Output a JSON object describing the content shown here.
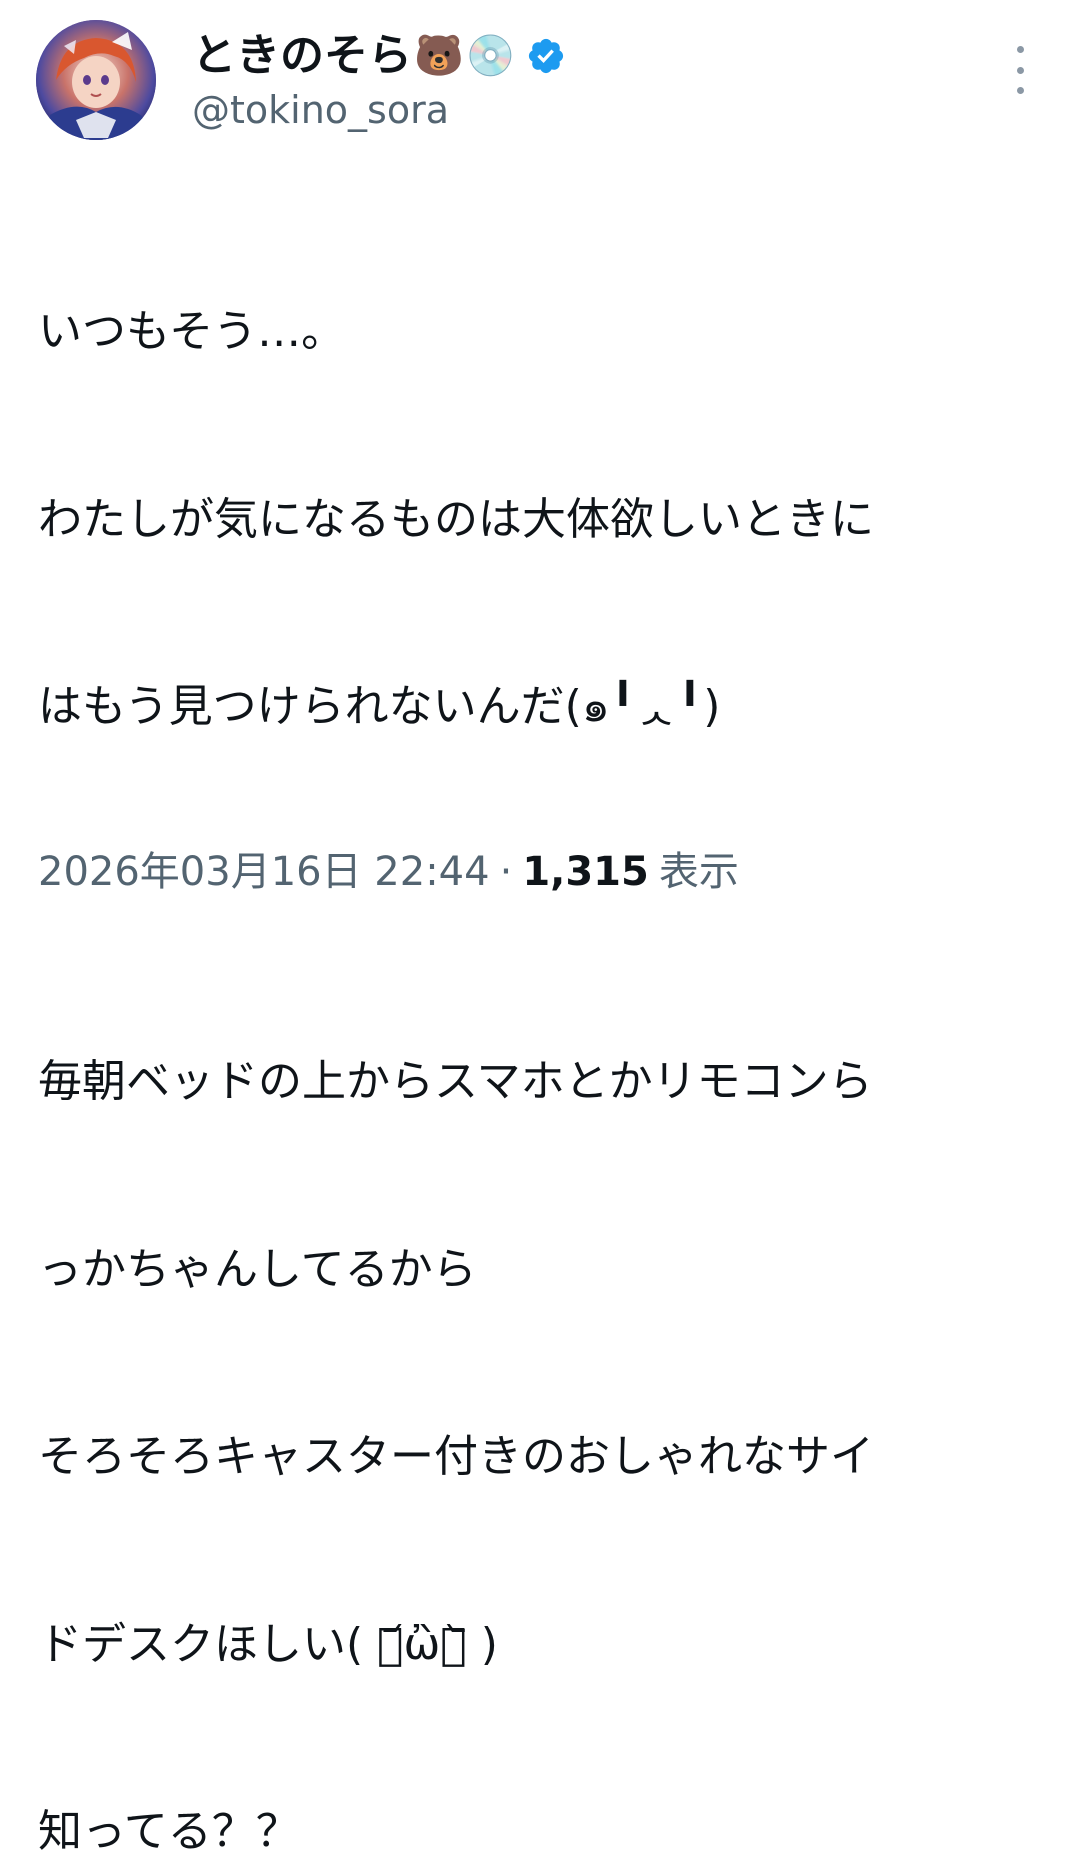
{
  "author": {
    "display_name": "ときのそら",
    "name_emojis": [
      "🐻",
      "💿"
    ],
    "verified": true,
    "handle": "@tokino_sora",
    "verified_color": "#1d9bf0"
  },
  "tweet": {
    "lines": [
      "いつもそう…。",
      "わたしが気になるものは大体欲しいときに",
      "はもう見つけられないんだ(๑╹ᆺ╹)",
      "",
      "毎朝ベッドの上からスマホとかリモコンら",
      "っかちゃんしてるから",
      "そろそろキャスター付きのおしゃれなサイ",
      "ドデスクほしい( ･᷄ὢ･᷅ )",
      "知ってる？？"
    ]
  },
  "meta": {
    "timestamp": "2026年03月16日 22:44",
    "separator": "·",
    "view_count": "1,315",
    "view_label": "表示"
  },
  "icons": {
    "more": "more-vertical-icon",
    "verified": "verified-badge-icon"
  }
}
